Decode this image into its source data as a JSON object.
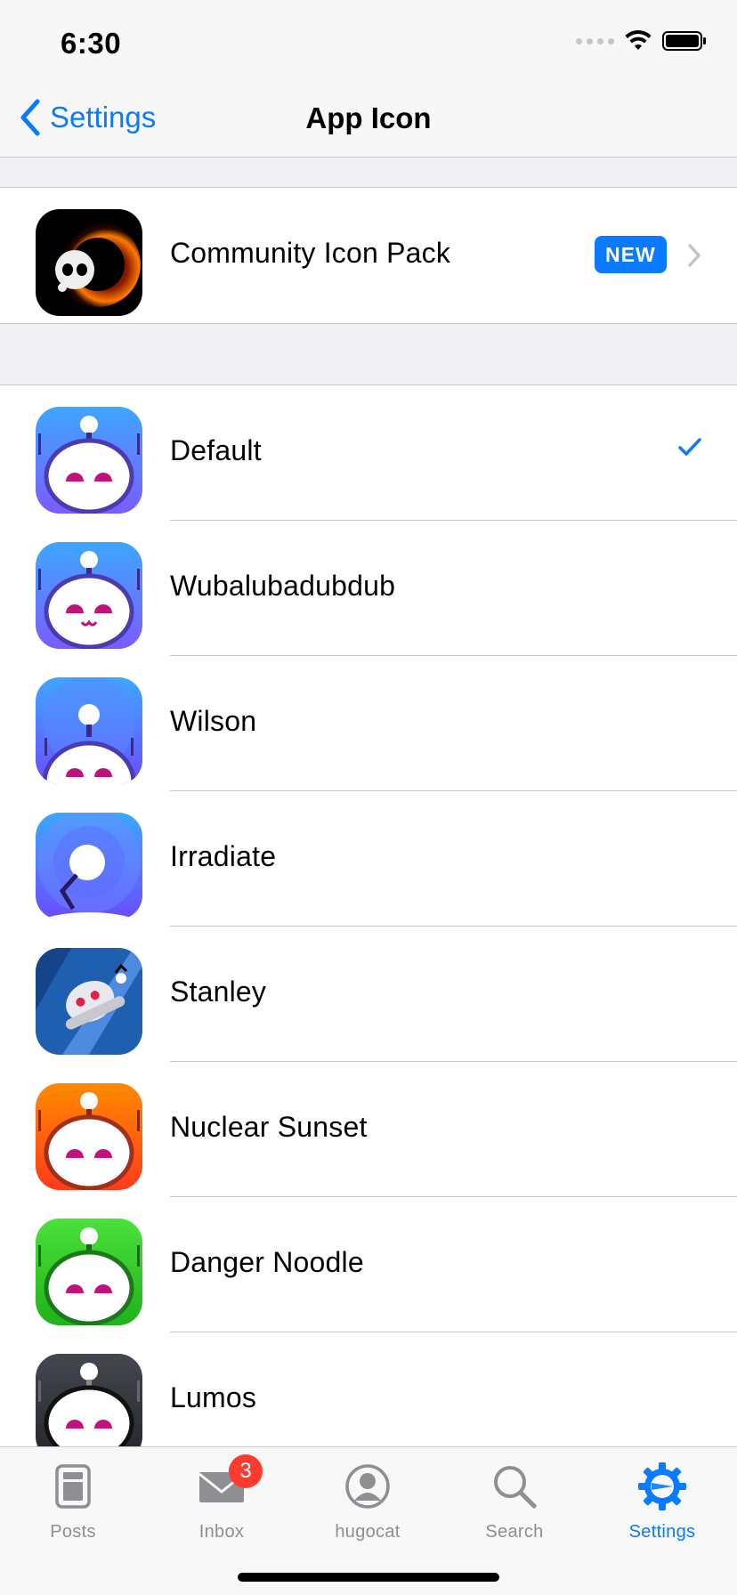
{
  "status": {
    "time": "6:30"
  },
  "nav": {
    "back_label": "Settings",
    "title": "App Icon"
  },
  "community": {
    "label": "Community Icon Pack",
    "badge": "NEW"
  },
  "icons": [
    {
      "label": "Default",
      "selected": true,
      "theme": "purple-blue"
    },
    {
      "label": "Wubalubadubdub",
      "selected": false,
      "theme": "purple-blue"
    },
    {
      "label": "Wilson",
      "selected": false,
      "theme": "purple-blue"
    },
    {
      "label": "Irradiate",
      "selected": false,
      "theme": "blue-purple"
    },
    {
      "label": "Stanley",
      "selected": false,
      "theme": "dark-blue"
    },
    {
      "label": "Nuclear Sunset",
      "selected": false,
      "theme": "orange"
    },
    {
      "label": "Danger Noodle",
      "selected": false,
      "theme": "green"
    },
    {
      "label": "Lumos",
      "selected": false,
      "theme": "dark-gray"
    }
  ],
  "tabs": [
    {
      "label": "Posts",
      "icon": "posts-icon"
    },
    {
      "label": "Inbox",
      "icon": "inbox-icon",
      "badge": "3"
    },
    {
      "label": "hugocat",
      "icon": "profile-icon"
    },
    {
      "label": "Search",
      "icon": "search-icon"
    },
    {
      "label": "Settings",
      "icon": "settings-icon",
      "active": true
    }
  ],
  "colors": {
    "accent": "#0a7aff",
    "badge_red": "#ff3b30",
    "separator": "#c8c7cc",
    "background": "#efeff4"
  }
}
